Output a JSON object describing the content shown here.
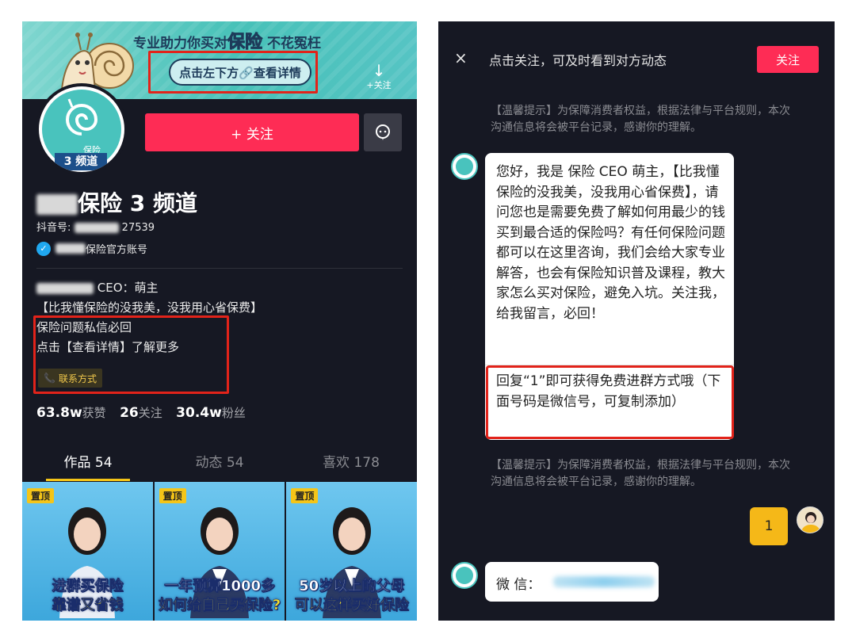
{
  "left": {
    "banner": {
      "title_prefix": "专业助力你买对",
      "title_highlight": "保险",
      "title_suffix": "不花冤枉",
      "pill": "点击左下方🔗查看详情",
      "follow_hint": "+关注"
    },
    "avatar": {
      "tag": "3 频道",
      "side_text": "保险"
    },
    "follow_button": "+ 关注",
    "profile_name": "保险 3 频道",
    "douyin_id_label": "抖音号:",
    "douyin_id_value": "27539",
    "verified_text": "保险官方账号",
    "bio": {
      "line1": "CEO：萌主",
      "line2": "【比我懂保险的没我美，没我用心省保费】",
      "line3": "保险问题私信必回",
      "line4": "点击【查看详情】了解更多"
    },
    "contact_chip": "联系方式",
    "stats": {
      "likes_num": "63.8w",
      "likes_label": "获赞",
      "following_num": "26",
      "following_label": "关注",
      "fans_num": "30.4w",
      "fans_label": "粉丝"
    },
    "tabs": [
      {
        "label": "作品 54",
        "active": true
      },
      {
        "label": "动态 54",
        "active": false
      },
      {
        "label": "喜欢 178",
        "active": false
      }
    ],
    "thumbs": [
      {
        "pin": "置顶",
        "cap1": "进群买保险",
        "cap2": "靠谱又省钱"
      },
      {
        "pin": "置顶",
        "cap1": "一年预算1000多",
        "cap2": "如何给自己买保险?"
      },
      {
        "pin": "置顶",
        "cap1": "50岁以上的父母",
        "cap2": "可以这样买好保险"
      }
    ]
  },
  "right": {
    "notice": {
      "close": "×",
      "text": "点击关注，可及时看到对方动态",
      "follow": "关注"
    },
    "tip1": "【温馨提示】为保障消费者权益，根据法律与平台规则，本次沟通信息将会被平台记录，感谢你的理解。",
    "message_main": "您好，我是 保险 CEO 萌主，【比我懂保险的没我美，没我用心省保费】，请问您也是需要免费了解如何用最少的钱买到最合适的保险吗？有任何保险问题都可以在这里咨询，我们会给大家专业解答，也会有保险知识普及课程，教大家怎么买对保险，避免入坑。关注我，给我留言，必回！",
    "message_reply": "回复“1”即可获得免费进群方式哦（下面号码是微信号，可复制添加）",
    "tip2": "【温馨提示】为保障消费者权益，根据法律与平台规则，本次沟通信息将会被平台记录，感谢你的理解。",
    "user_message": "1",
    "wechat_label": "微 信："
  }
}
